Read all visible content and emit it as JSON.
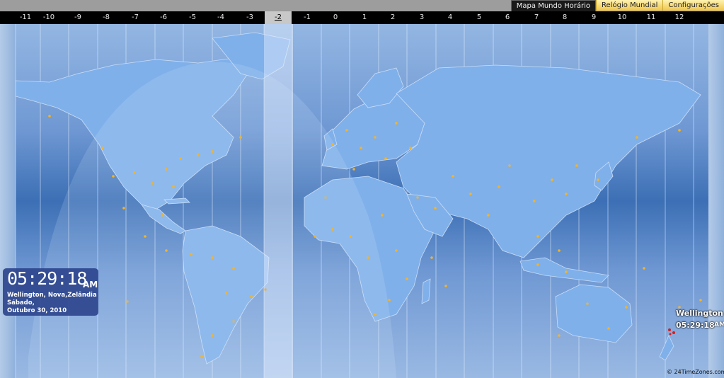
{
  "tabs": [
    {
      "label": "Mapa Mundo Horário",
      "active": true
    },
    {
      "label": "Relógio Mundial",
      "active": false
    },
    {
      "label": "Configurações",
      "active": false
    }
  ],
  "timezones": [
    "-11",
    "-10",
    "-9",
    "-8",
    "-7",
    "-6",
    "-5",
    "-4",
    "-3",
    "-2",
    "-1",
    "0",
    "1",
    "2",
    "3",
    "4",
    "5",
    "6",
    "7",
    "8",
    "9",
    "10",
    "11",
    "12"
  ],
  "selected_timezone": "-2",
  "clock": {
    "time": "05:29:18",
    "ampm": "AM",
    "city": "Wellington, Nova,Zelândia",
    "day": "Sábado,",
    "date": "Outubro 30, 2010"
  },
  "marker": {
    "city": "Wellington",
    "time": "05:29:18",
    "ampm": "AM"
  },
  "copyright": "© 24TimeZones.com",
  "colors": {
    "ocean_light": "#93b6e2",
    "ocean_dark": "#3c6fb5",
    "land": "#80b0ea",
    "city_dot": "#f5b324",
    "clock_bg": "#2c448c",
    "marker": "#d31f1f"
  }
}
